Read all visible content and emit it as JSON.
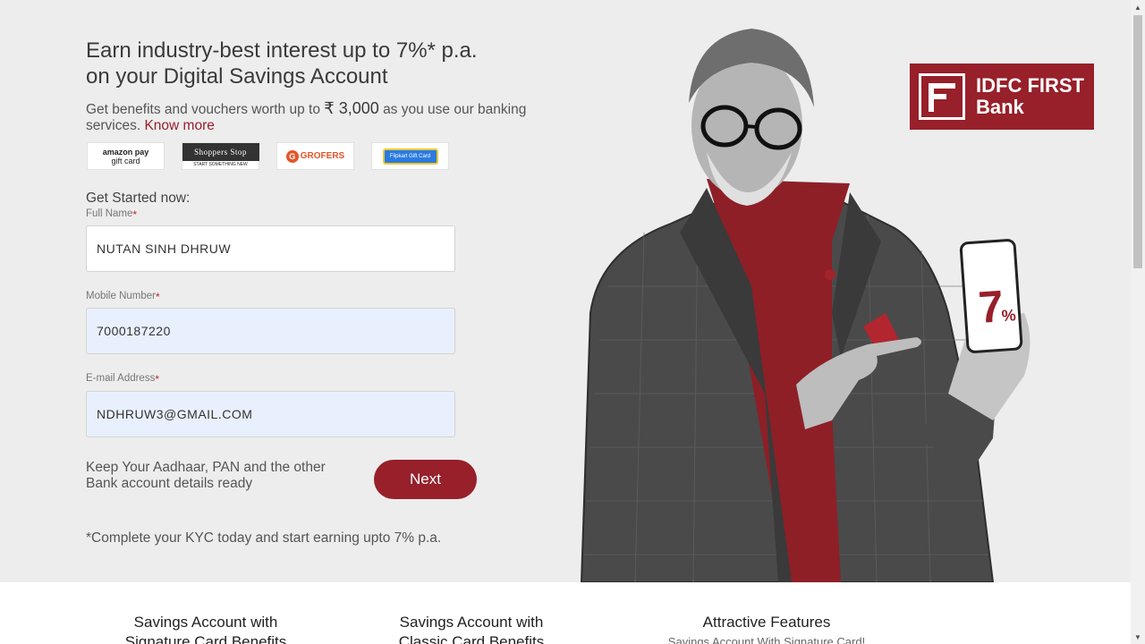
{
  "hero": {
    "headline_line1": "Earn industry-best interest up to 7%* p.a.",
    "headline_line2": "on your Digital Savings Account",
    "sub_prefix": "Get benefits and vouchers worth up to",
    "sub_amount": "₹ 3,000",
    "sub_suffix": "as you use our banking services.",
    "know_more": "Know more"
  },
  "vouchers": {
    "amazon_line1": "amazon pay",
    "amazon_line2": "gift card",
    "shoppers_top": "Shoppers Stop",
    "shoppers_bottom": "START SOMETHING NEW",
    "grofers": "GROFERS",
    "flipkart": "Flipkart Gift Card"
  },
  "form": {
    "heading": "Get Started now:",
    "full_name_label": "Full Name",
    "full_name_value": "NUTAN SINH DHRUW",
    "mobile_label": "Mobile Number",
    "mobile_value": "7000187220",
    "email_label": "E-mail Address",
    "email_value": "NDHRUW3@GMAIL.COM",
    "required_mark": "*",
    "note": "Keep Your Aadhaar, PAN and the other Bank account details ready",
    "next_label": "Next",
    "footnote": "*Complete your KYC today and start earning upto 7% p.a."
  },
  "brand": {
    "line1": "IDFC FIRST",
    "line2": "Bank",
    "accent_color": "#97202a"
  },
  "phone": {
    "big": "7",
    "small": "%"
  },
  "tabs": [
    {
      "line1": "Savings Account with",
      "line2": "Signature Card Benefits"
    },
    {
      "line1": "Savings Account with",
      "line2": "Classic Card Benefits"
    },
    {
      "line1": "Attractive Features",
      "line2": "Savings Account With Signature Card!"
    }
  ]
}
